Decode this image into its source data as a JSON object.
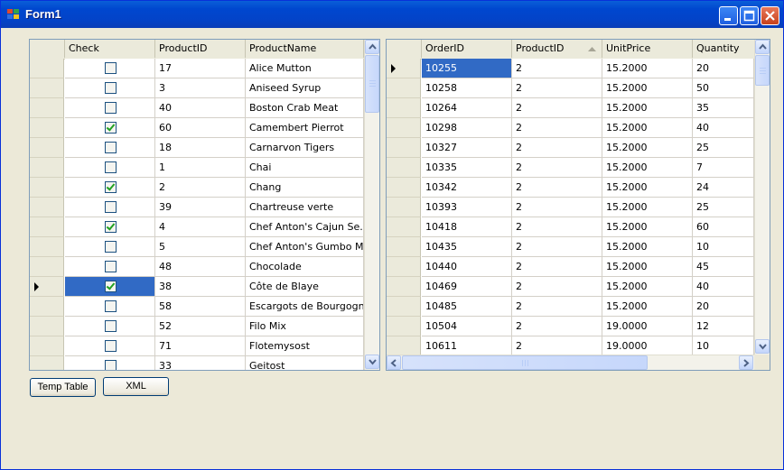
{
  "window": {
    "title": "Form1"
  },
  "products_grid": {
    "columns": [
      "Check",
      "ProductID",
      "ProductName"
    ],
    "rows": [
      {
        "checked": false,
        "product_id": "17",
        "product_name": "Alice Mutton"
      },
      {
        "checked": false,
        "product_id": "3",
        "product_name": "Aniseed Syrup"
      },
      {
        "checked": false,
        "product_id": "40",
        "product_name": "Boston Crab Meat"
      },
      {
        "checked": true,
        "product_id": "60",
        "product_name": "Camembert Pierrot"
      },
      {
        "checked": false,
        "product_id": "18",
        "product_name": "Carnarvon Tigers"
      },
      {
        "checked": false,
        "product_id": "1",
        "product_name": "Chai"
      },
      {
        "checked": true,
        "product_id": "2",
        "product_name": "Chang"
      },
      {
        "checked": false,
        "product_id": "39",
        "product_name": "Chartreuse verte"
      },
      {
        "checked": true,
        "product_id": "4",
        "product_name": "Chef Anton's Cajun Se..."
      },
      {
        "checked": false,
        "product_id": "5",
        "product_name": "Chef Anton's Gumbo Mix"
      },
      {
        "checked": false,
        "product_id": "48",
        "product_name": "Chocolade"
      },
      {
        "checked": true,
        "product_id": "38",
        "product_name": "Côte de Blaye",
        "current": true,
        "selected_cell": "check"
      },
      {
        "checked": false,
        "product_id": "58",
        "product_name": "Escargots de Bourgogne"
      },
      {
        "checked": false,
        "product_id": "52",
        "product_name": "Filo Mix"
      },
      {
        "checked": false,
        "product_id": "71",
        "product_name": "Flotemysost"
      },
      {
        "checked": false,
        "product_id": "33",
        "product_name": "Geitost"
      }
    ]
  },
  "orders_grid": {
    "columns": [
      "OrderID",
      "ProductID",
      "UnitPrice",
      "Quantity"
    ],
    "sorted_column": "ProductID",
    "rows": [
      {
        "order_id": "10255",
        "product_id": "2",
        "unit_price": "15.2000",
        "quantity": "20",
        "current": true,
        "selected_cell": "order_id"
      },
      {
        "order_id": "10258",
        "product_id": "2",
        "unit_price": "15.2000",
        "quantity": "50"
      },
      {
        "order_id": "10264",
        "product_id": "2",
        "unit_price": "15.2000",
        "quantity": "35"
      },
      {
        "order_id": "10298",
        "product_id": "2",
        "unit_price": "15.2000",
        "quantity": "40"
      },
      {
        "order_id": "10327",
        "product_id": "2",
        "unit_price": "15.2000",
        "quantity": "25"
      },
      {
        "order_id": "10335",
        "product_id": "2",
        "unit_price": "15.2000",
        "quantity": "7"
      },
      {
        "order_id": "10342",
        "product_id": "2",
        "unit_price": "15.2000",
        "quantity": "24"
      },
      {
        "order_id": "10393",
        "product_id": "2",
        "unit_price": "15.2000",
        "quantity": "25"
      },
      {
        "order_id": "10418",
        "product_id": "2",
        "unit_price": "15.2000",
        "quantity": "60"
      },
      {
        "order_id": "10435",
        "product_id": "2",
        "unit_price": "15.2000",
        "quantity": "10"
      },
      {
        "order_id": "10440",
        "product_id": "2",
        "unit_price": "15.2000",
        "quantity": "45"
      },
      {
        "order_id": "10469",
        "product_id": "2",
        "unit_price": "15.2000",
        "quantity": "40"
      },
      {
        "order_id": "10485",
        "product_id": "2",
        "unit_price": "15.2000",
        "quantity": "20"
      },
      {
        "order_id": "10504",
        "product_id": "2",
        "unit_price": "19.0000",
        "quantity": "12"
      },
      {
        "order_id": "10611",
        "product_id": "2",
        "unit_price": "19.0000",
        "quantity": "10"
      }
    ]
  },
  "buttons": {
    "temp_table": "Temp Table",
    "xml": "XML"
  },
  "colors": {
    "selection": "#316ac5",
    "title_bar": "#0047cf",
    "form_background": "#ece9d8"
  }
}
